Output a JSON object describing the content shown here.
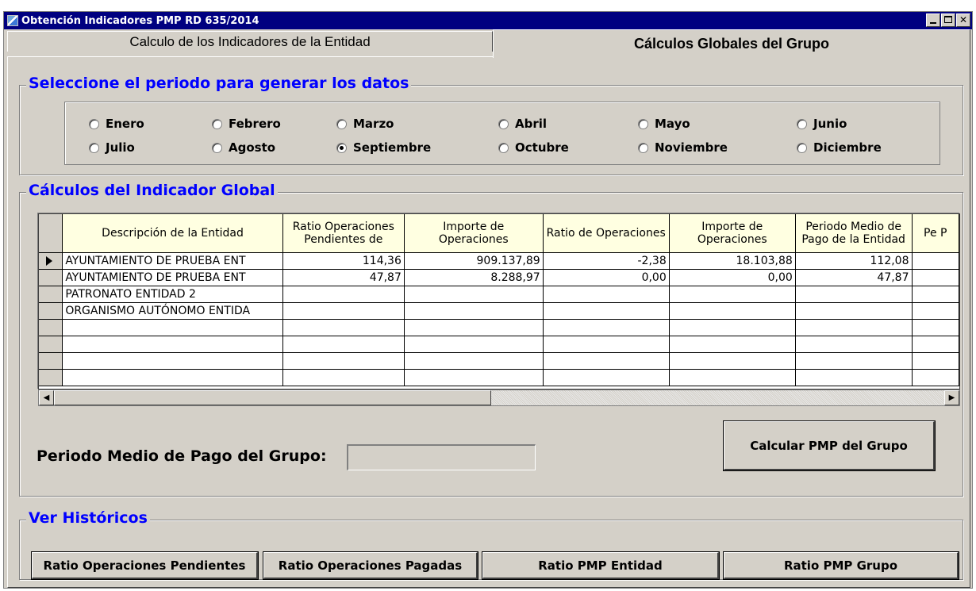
{
  "window": {
    "title": "Obtención Indicadores PMP RD 635/2014"
  },
  "tabs": [
    {
      "label": "Calculo de los Indicadores de la Entidad",
      "active": false
    },
    {
      "label": "Cálculos Globales del Grupo",
      "active": true
    }
  ],
  "periodo": {
    "legend": "Seleccione el periodo para generar los datos",
    "months": [
      "Enero",
      "Febrero",
      "Marzo",
      "Abril",
      "Mayo",
      "Junio",
      "Julio",
      "Agosto",
      "Septiembre",
      "Octubre",
      "Noviembre",
      "Diciembre"
    ],
    "selected": "Septiembre"
  },
  "indicador": {
    "legend": "Cálculos del Indicador Global",
    "columns": [
      "Descripción de la Entidad",
      "Ratio Operaciones Pendientes de",
      "Importe de Operaciones",
      "Ratio de Operaciones",
      "Importe de Operaciones",
      "Periodo Medio de Pago de la Entidad",
      "Pe P"
    ],
    "rows": [
      [
        "AYUNTAMIENTO DE PRUEBA ENT",
        "114,36",
        "909.137,89",
        "-2,38",
        "18.103,88",
        "112,08",
        ""
      ],
      [
        "AYUNTAMIENTO DE PRUEBA ENT",
        "47,87",
        "8.288,97",
        "0,00",
        "0,00",
        "47,87",
        ""
      ],
      [
        "PATRONATO ENTIDAD 2",
        "",
        "",
        "",
        "",
        "",
        ""
      ],
      [
        "ORGANISMO AUTÓNOMO ENTIDA",
        "",
        "",
        "",
        "",
        "",
        ""
      ],
      [
        "",
        "",
        "",
        "",
        "",
        "",
        ""
      ],
      [
        "",
        "",
        "",
        "",
        "",
        "",
        ""
      ],
      [
        "",
        "",
        "",
        "",
        "",
        "",
        ""
      ],
      [
        "",
        "",
        "",
        "",
        "",
        "",
        ""
      ]
    ],
    "pmp_label": "Periodo Medio de Pago del Grupo:",
    "pmp_value": "",
    "calc_button": "Calcular PMP del Grupo"
  },
  "historicos": {
    "legend": "Ver Históricos",
    "buttons": [
      "Ratio Operaciones Pendientes",
      "Ratio Operaciones Pagadas",
      "Ratio PMP Entidad",
      "Ratio PMP Grupo"
    ]
  }
}
